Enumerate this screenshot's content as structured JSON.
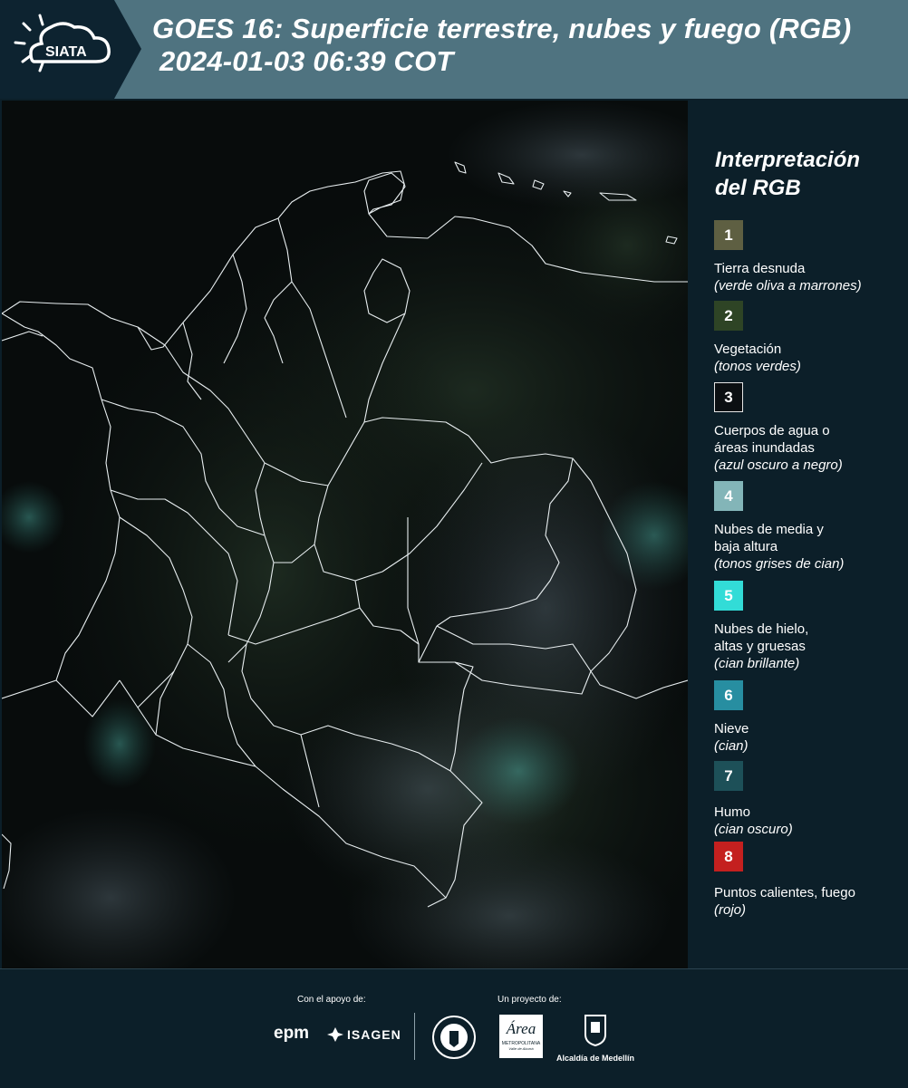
{
  "header": {
    "logo_text": "SIATA",
    "title_line1": "GOES 16: Superficie terrestre, nubes y fuego (RGB)",
    "title_line2": "2024-01-03 06:39 COT"
  },
  "legend": {
    "title_line1": "Interpretación",
    "title_line2": "del RGB",
    "items": [
      {
        "number": "1",
        "color": "#5e5f42",
        "label": "Tierra desnuda",
        "desc": "(verde oliva a marrones)"
      },
      {
        "number": "2",
        "color": "#2e4425",
        "label": "Vegetación",
        "desc": "(tonos verdes)"
      },
      {
        "number": "3",
        "color": "#0b0f12",
        "label": "Cuerpos de agua o áreas inundadas",
        "desc": "(azul oscuro a negro)"
      },
      {
        "number": "4",
        "color": "#83b5b8",
        "label": "Nubes de media y baja altura",
        "desc": "(tonos grises de cian)"
      },
      {
        "number": "5",
        "color": "#32dcd7",
        "label": "Nubes de hielo, altas y gruesas",
        "desc": "(cian brillante)"
      },
      {
        "number": "6",
        "color": "#278ea1",
        "label": "Nieve",
        "desc": "(cian)"
      },
      {
        "number": "7",
        "color": "#1d5058",
        "label": "Humo",
        "desc": "(cian oscuro)"
      },
      {
        "number": "8",
        "color": "#c4201f",
        "label": "Puntos calientes, fuego",
        "desc": "(rojo)"
      }
    ]
  },
  "footer": {
    "support_label": "Con el apoyo de:",
    "project_label": "Un proyecto de:",
    "epm_text": "epm",
    "isagen_text": "ISAGEN",
    "area_text": "Área",
    "area_subtext": "METROPOLITANA",
    "area_subtext2": "Valle de Aburrá",
    "alcaldia_text": "Alcaldía de Medellín"
  }
}
